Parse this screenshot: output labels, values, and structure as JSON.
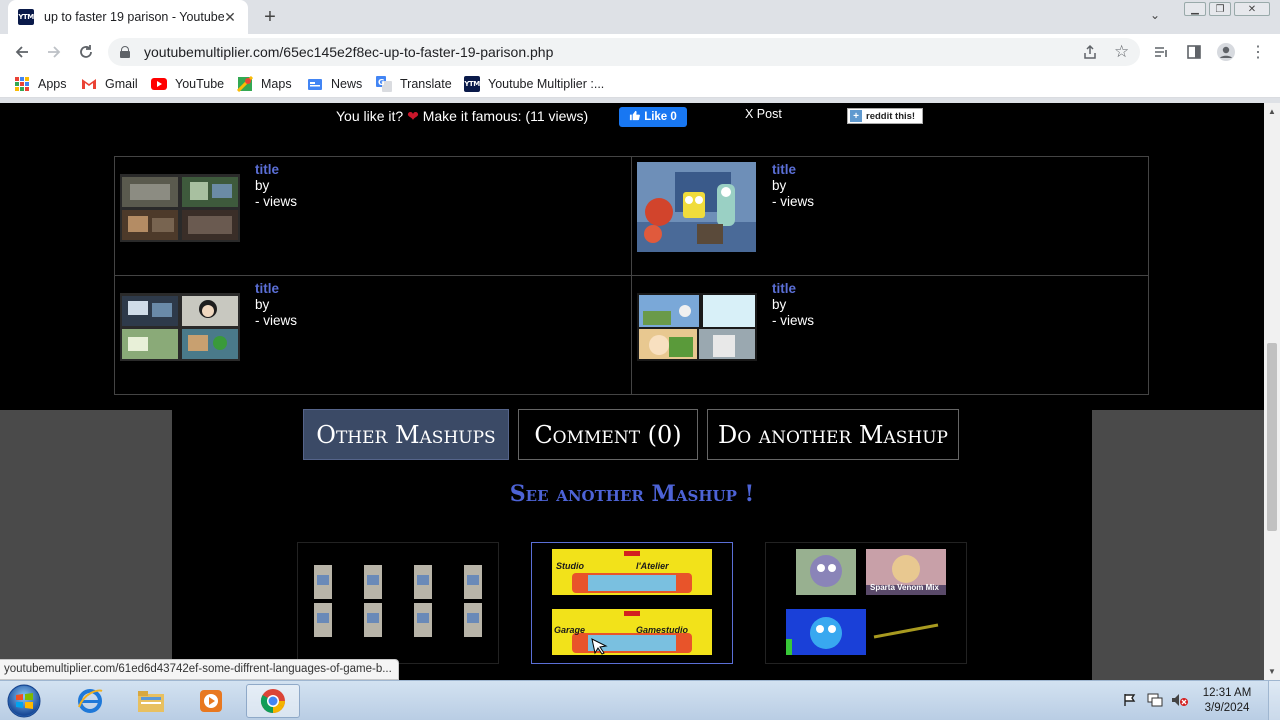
{
  "browser": {
    "tab": {
      "favicon_text": "YTM",
      "title": "up to faster 19 parison - Youtube"
    },
    "url_host": "youtubemultiplier.com",
    "url_path": "/65ec145e2f8ec-up-to-faster-19-parison.php",
    "bookmarks": [
      {
        "label": "Apps",
        "icon": "apps-grid-icon"
      },
      {
        "label": "Gmail",
        "icon": "gmail-icon"
      },
      {
        "label": "YouTube",
        "icon": "youtube-icon"
      },
      {
        "label": "Maps",
        "icon": "maps-icon"
      },
      {
        "label": "News",
        "icon": "news-icon"
      },
      {
        "label": "Translate",
        "icon": "translate-icon"
      },
      {
        "label": "Youtube Multiplier :...",
        "icon": "ytm-icon"
      }
    ]
  },
  "page": {
    "share": {
      "prompt": "You like it?",
      "prompt_after": "Make it famous: (11 views)",
      "fb_like": "Like 0",
      "x_post": "X Post",
      "reddit": "reddit this!"
    },
    "videos": [
      {
        "title": "title",
        "by": "by",
        "views": "- views"
      },
      {
        "title": "title",
        "by": "by",
        "views": "- views"
      },
      {
        "title": "title",
        "by": "by",
        "views": "- views"
      },
      {
        "title": "title",
        "by": "by",
        "views": "- views"
      }
    ],
    "nav_buttons": [
      "Other Mashups",
      "Comment (0)",
      "Do another Mashup"
    ],
    "see_another": "See another Mashup !",
    "mashup_thumbs": {
      "second": [
        "Studio",
        "l'Atelier",
        "Garage",
        "Gamestudio"
      ],
      "third_caption": "Sparta Venom Mix"
    }
  },
  "status_url": "youtubemultiplier.com/61ed6d43742ef-some-diffrent-languages-of-game-b...",
  "taskbar": {
    "time": "12:31 AM",
    "date": "3/9/2024"
  },
  "colors": {
    "accent_link": "#5b6fd6",
    "heading_blue": "#4d63d6",
    "active_button": "#3b4a66",
    "facebook": "#1877f2"
  }
}
